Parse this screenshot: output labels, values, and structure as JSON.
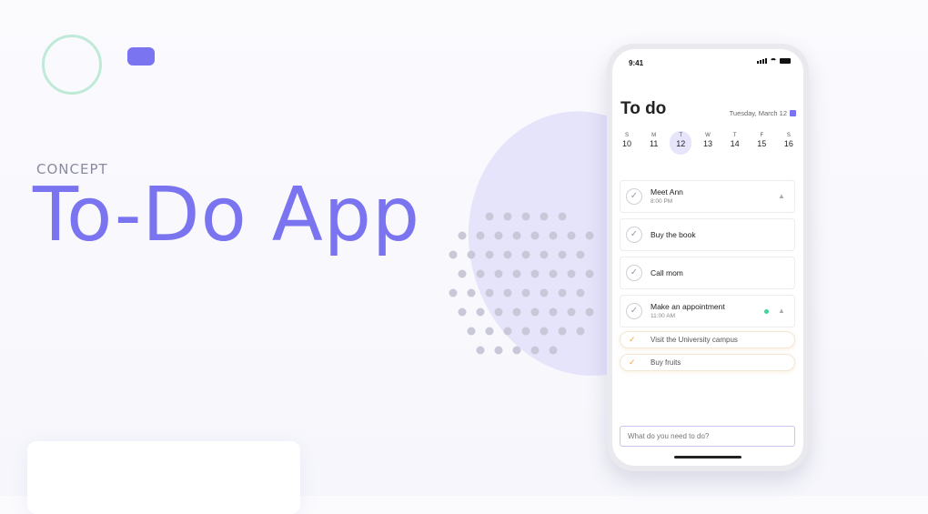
{
  "hero": {
    "kicker": "CONCEPT",
    "title": "To-Do App"
  },
  "phone": {
    "time": "9:41",
    "title": "To do",
    "date": "Tuesday, March 12",
    "week": [
      {
        "letter": "S",
        "num": "10",
        "selected": false
      },
      {
        "letter": "M",
        "num": "11",
        "selected": false
      },
      {
        "letter": "T",
        "num": "12",
        "selected": true
      },
      {
        "letter": "W",
        "num": "13",
        "selected": false
      },
      {
        "letter": "T",
        "num": "14",
        "selected": false
      },
      {
        "letter": "F",
        "num": "15",
        "selected": false
      },
      {
        "letter": "S",
        "num": "16",
        "selected": false
      }
    ],
    "tasks": [
      {
        "title": "Meet Ann",
        "time": "8:00 PM",
        "bell": true,
        "dot": false
      },
      {
        "title": "Buy the book",
        "time": "",
        "bell": false,
        "dot": false
      },
      {
        "title": "Call mom",
        "time": "",
        "bell": false,
        "dot": false
      },
      {
        "title": "Make an appointment",
        "time": "11:00 AM",
        "bell": true,
        "dot": true
      }
    ],
    "completed": [
      {
        "title": "Visit the University campus"
      },
      {
        "title": "Buy fruits"
      }
    ],
    "input_placeholder": "What do you need to do?"
  },
  "colors": {
    "accent": "#7a74f0",
    "blob": "#e6e4fb",
    "done": "#f2a23a",
    "dot": "#44d39a"
  }
}
